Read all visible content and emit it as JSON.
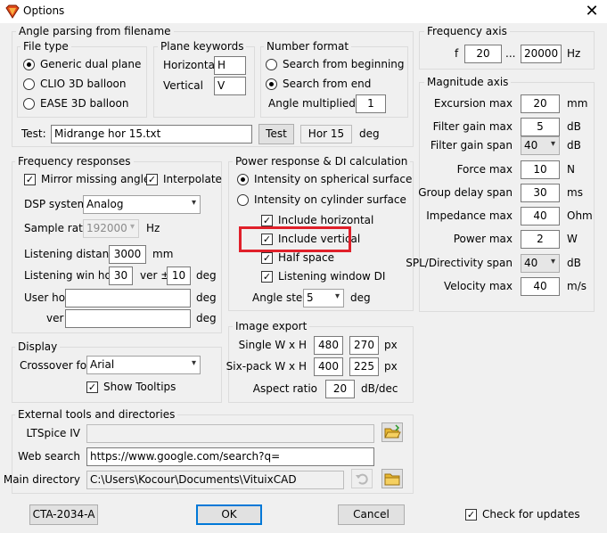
{
  "window": {
    "title": "Options",
    "close": "✕"
  },
  "angle_parsing": {
    "legend": "Angle parsing from filename",
    "file_type": {
      "legend": "File type",
      "options": [
        "Generic dual plane",
        "CLIO 3D balloon",
        "EASE 3D balloon"
      ],
      "selected": 0
    },
    "plane_keywords": {
      "legend": "Plane keywords",
      "horizontal_label": "Horizontal",
      "horizontal_value": "H",
      "vertical_label": "Vertical",
      "vertical_value": "V"
    },
    "number_format": {
      "legend": "Number format",
      "options": [
        "Search from beginning",
        "Search from end"
      ],
      "selected": 1,
      "multiplier_label": "Angle multiplied by",
      "multiplier_value": "1"
    },
    "test_label": "Test:",
    "test_value": "Midrange hor 15.txt",
    "test_button": "Test",
    "test_result": "Hor 15",
    "test_unit": "deg"
  },
  "frequency_axis": {
    "legend": "Frequency axis",
    "f_label": "f",
    "from": "20",
    "sep": "...",
    "to": "20000",
    "unit": "Hz"
  },
  "magnitude_axis": {
    "legend": "Magnitude axis",
    "rows": [
      {
        "label": "Excursion max",
        "value": "20",
        "unit": "mm"
      },
      {
        "label": "Filter gain max",
        "value": "5",
        "unit": "dB"
      },
      {
        "label": "Filter gain span",
        "value": "40",
        "unit": "dB"
      },
      {
        "label": "Force max",
        "value": "10",
        "unit": "N"
      },
      {
        "label": "Group delay span",
        "value": "30",
        "unit": "ms"
      },
      {
        "label": "Impedance max",
        "value": "40",
        "unit": "Ohm"
      },
      {
        "label": "Power max",
        "value": "2",
        "unit": "W"
      },
      {
        "label": "SPL/Directivity span",
        "value": "40",
        "unit": "dB"
      },
      {
        "label": "Velocity max",
        "value": "40",
        "unit": "m/s"
      }
    ]
  },
  "frequency_responses": {
    "legend": "Frequency responses",
    "mirror_label": "Mirror missing angles",
    "mirror_checked": "✓",
    "interpolate_label": "Interpolate",
    "interpolate_checked": "✓",
    "dsp_label": "DSP system",
    "dsp_value": "Analog",
    "rate_label": "Sample rate",
    "rate_value": "192000",
    "rate_unit": "Hz",
    "dist_label": "Listening distance",
    "dist_value": "3000",
    "dist_unit": "mm",
    "win_label": "Listening win hor ±",
    "win_hor": "30",
    "win_ver_label": "ver ±",
    "win_ver": "10",
    "win_unit": "deg",
    "user_hor_label": "User hor",
    "user_hor_value": "",
    "user_hor_unit": "deg",
    "user_ver_label": "ver",
    "user_ver_value": "",
    "user_ver_unit": "deg"
  },
  "power_response": {
    "legend": "Power response & DI calculation",
    "options": [
      "Intensity on spherical surface",
      "Intensity on cylinder surface"
    ],
    "selected": 0,
    "checks": [
      {
        "label": "Include horizontal",
        "checked": "✓"
      },
      {
        "label": "Include vertical",
        "checked": "✓"
      },
      {
        "label": "Half space",
        "checked": "✓"
      },
      {
        "label": "Listening window DI",
        "checked": "✓"
      }
    ],
    "angle_step_label": "Angle step",
    "angle_step_value": "5",
    "angle_step_unit": "deg",
    "highlight_color": "#e0202a"
  },
  "display": {
    "legend": "Display",
    "font_label": "Crossover font",
    "font_value": "Arial",
    "tooltips_label": "Show Tooltips",
    "tooltips_checked": "✓"
  },
  "image_export": {
    "legend": "Image export",
    "single_label": "Single W x H",
    "single_w": "480",
    "single_h": "270",
    "single_unit": "px",
    "six_label": "Six-pack W x H",
    "six_w": "400",
    "six_h": "225",
    "six_unit": "px",
    "aspect_label": "Aspect ratio",
    "aspect_value": "20",
    "aspect_unit": "dB/dec"
  },
  "external_tools": {
    "legend": "External tools and directories",
    "ltspice_label": "LTSpice IV",
    "ltspice_value": "",
    "web_label": "Web search",
    "web_value": "https://www.google.com/search?q=",
    "main_label": "Main directory",
    "main_value": "C:\\Users\\Kocour\\Documents\\VituixCAD"
  },
  "footer": {
    "cta_button": "CTA-2034-A",
    "ok_button": "OK",
    "cancel_button": "Cancel",
    "updates_label": "Check for updates",
    "updates_checked": "✓"
  }
}
